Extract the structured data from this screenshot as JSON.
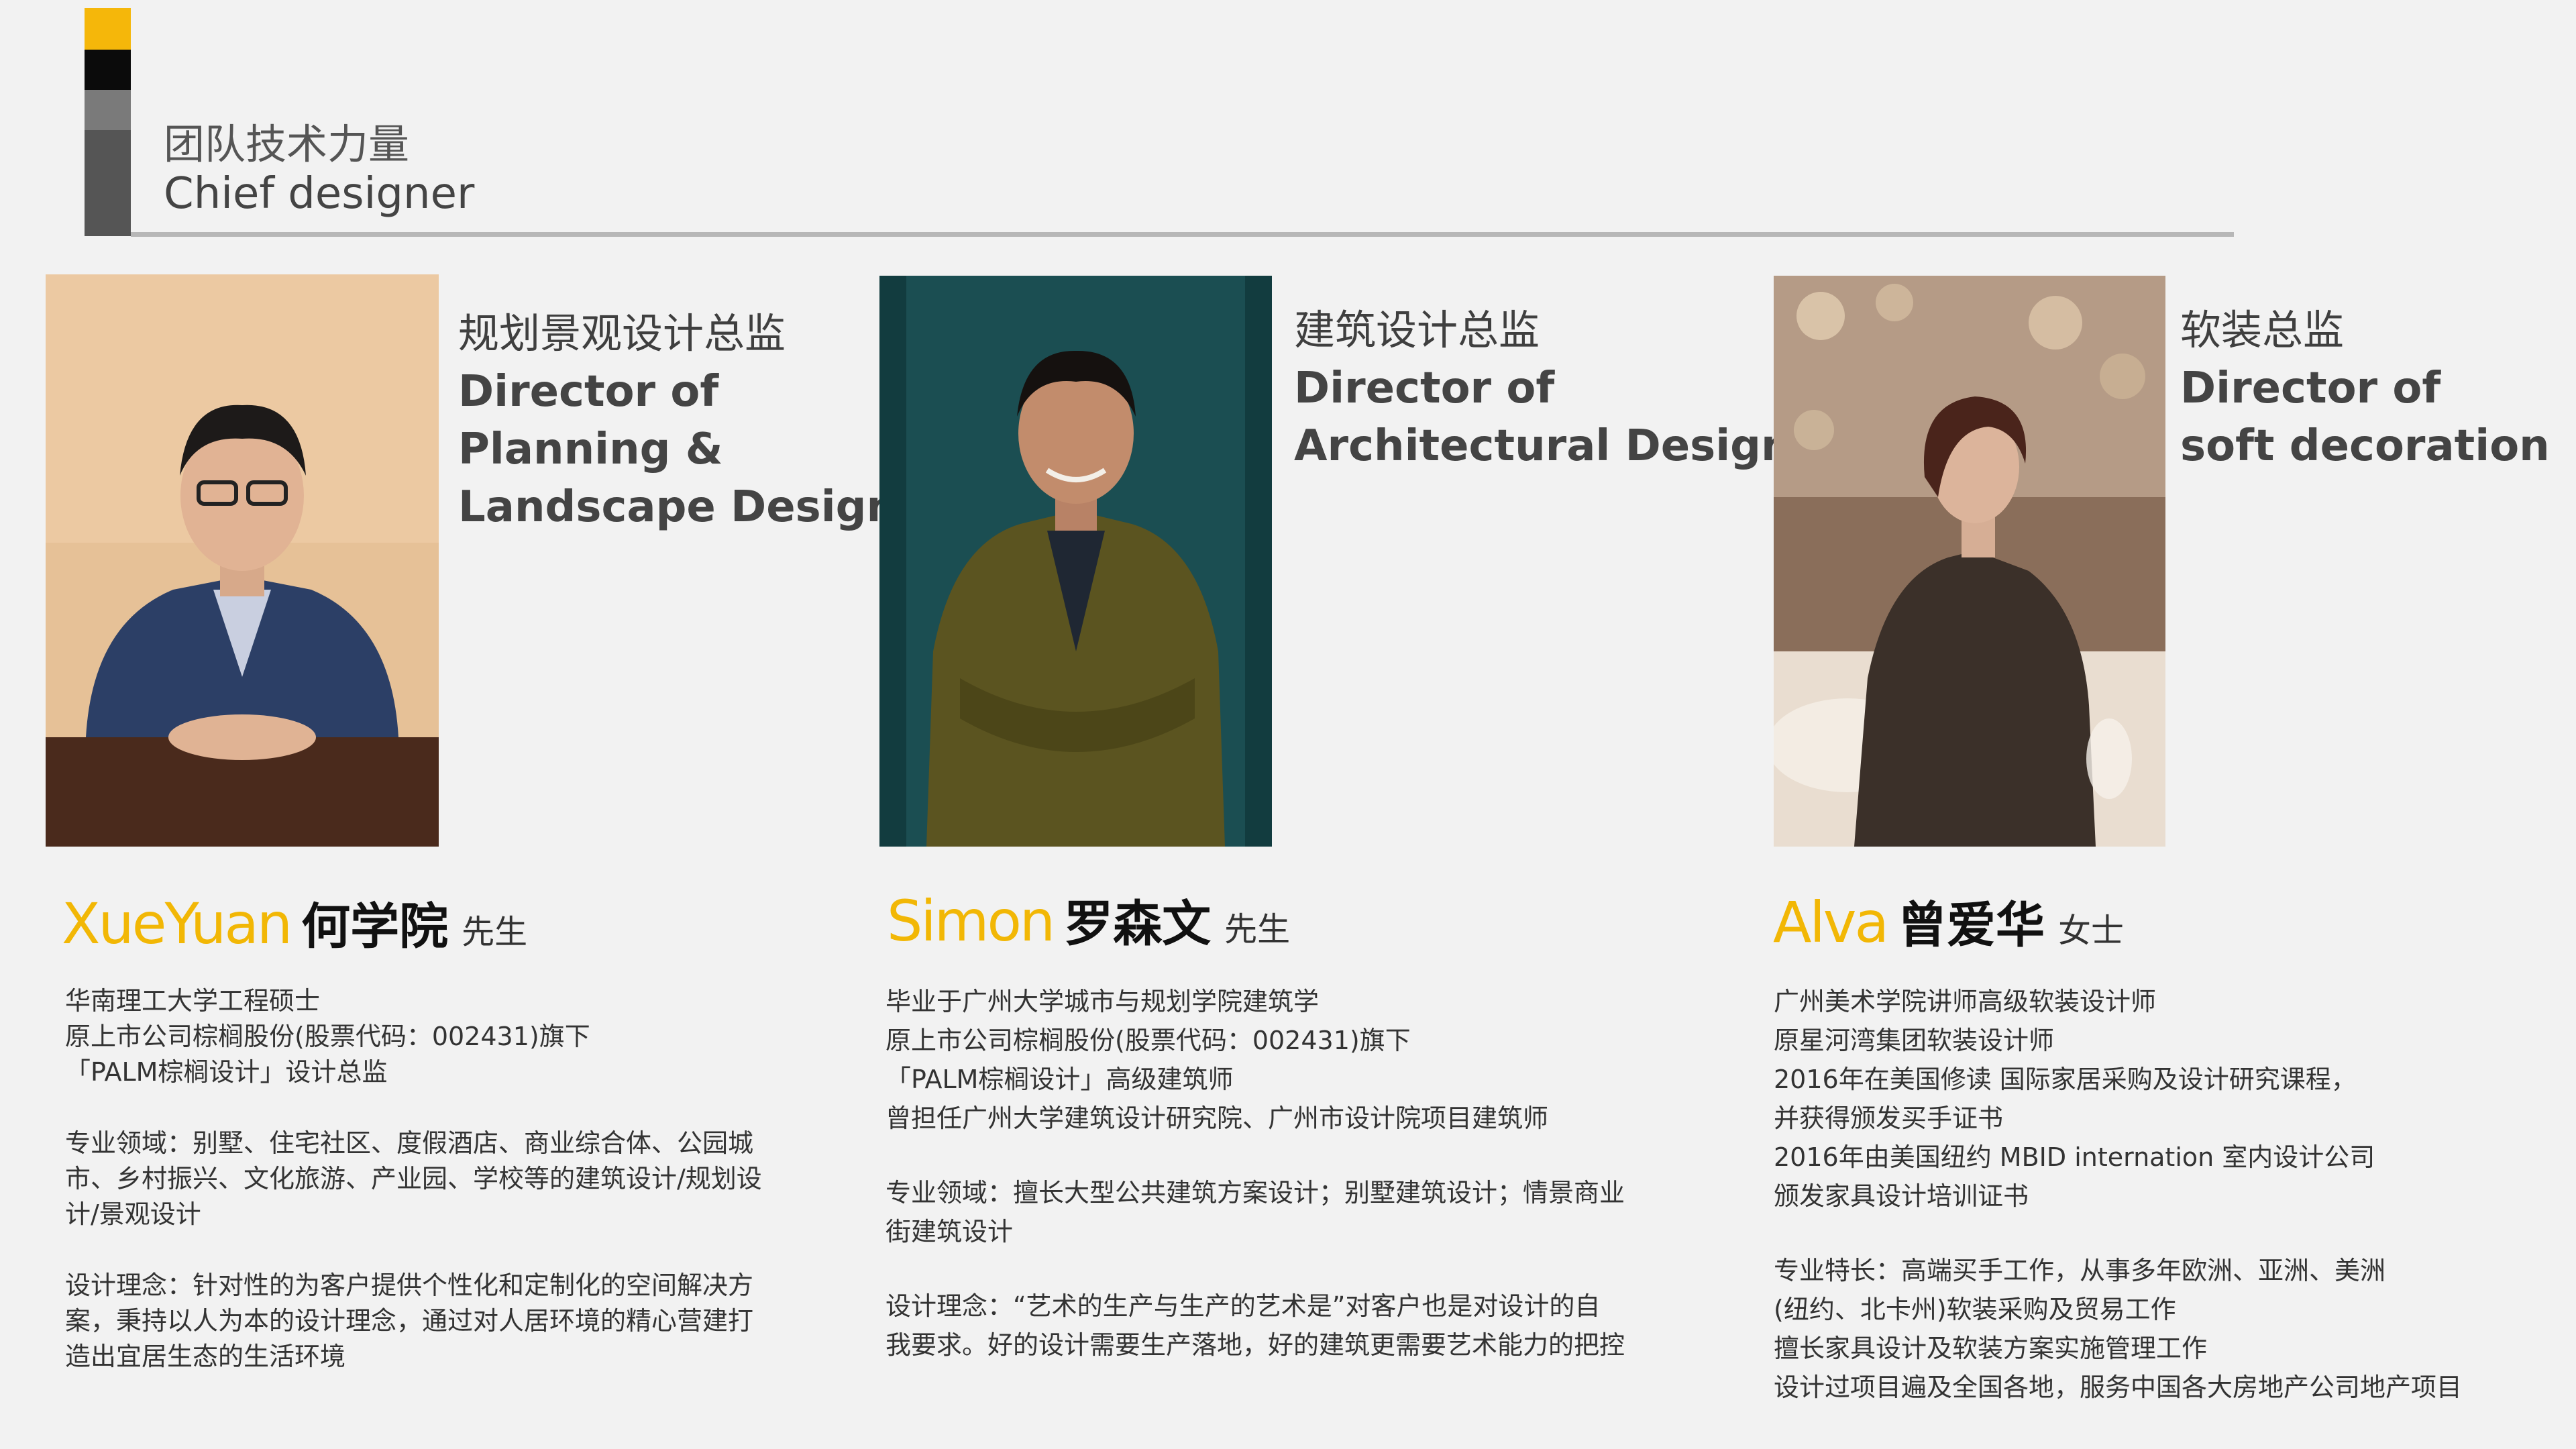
{
  "header": {
    "title_cn": "团队技术力量",
    "title_en": "Chief designer"
  },
  "designers": [
    {
      "role_cn": "规划景观设计总监",
      "role_en_lines": [
        "Director of",
        "Planning &",
        "Landscape Design"
      ],
      "name_en": "XueYuan",
      "name_cn": "何学院",
      "honorific": "先生",
      "bio_lines": [
        "华南理工大学工程硕士",
        "原上市公司棕榈股份(股票代码：002431)旗下",
        "「PALM棕榈设计」设计总监",
        "",
        "专业领域：别墅、住宅社区、度假酒店、商业综合体、公园城",
        "市、乡村振兴、文化旅游、产业园、学校等的建筑设计/规划设",
        "计/景观设计",
        "",
        "设计理念：针对性的为客户提供个性化和定制化的空间解决方",
        "案，秉持以人为本的设计理念，通过对人居环境的精心营建打",
        "造出宜居生态的生活环境"
      ]
    },
    {
      "role_cn": "建筑设计总监",
      "role_en_lines": [
        "Director of",
        "Architectural Design"
      ],
      "name_en": "Simon",
      "name_cn": "罗森文",
      "honorific": "先生",
      "bio_lines": [
        "毕业于广州大学城市与规划学院建筑学",
        "原上市公司棕榈股份(股票代码：002431)旗下",
        "「PALM棕榈设计」高级建筑师",
        "曾担任广州大学建筑设计研究院、广州市设计院项目建筑师",
        "",
        "专业领域：擅长大型公共建筑方案设计；别墅建筑设计；情景商业",
        "街建筑设计",
        "",
        "设计理念：“艺术的生产与生产的艺术是”对客户也是对设计的自",
        "我要求。好的设计需要生产落地，好的建筑更需要艺术能力的把控"
      ]
    },
    {
      "role_cn": "软装总监",
      "role_en_lines": [
        "Director of",
        "soft decoration"
      ],
      "name_en": "Alva",
      "name_cn": "曾爱华",
      "honorific": "女士",
      "bio_lines": [
        "广州美术学院讲师高级软装设计师",
        "原星河湾集团软装设计师",
        "2016年在美国修读 国际家居采购及设计研究课程，",
        "并获得颁发买手证书",
        "2016年由美国纽约 MBID internation 室内设计公司",
        "颁发家具设计培训证书",
        "",
        "专业特长：高端买手工作，从事多年欧洲、亚洲、美洲",
        "(纽约、北卡州)软装采购及贸易工作",
        "擅长家具设计及软装方案实施管理工作",
        "设计过项目遍及全国各地，服务中国各大房地产公司地产项目"
      ]
    }
  ]
}
